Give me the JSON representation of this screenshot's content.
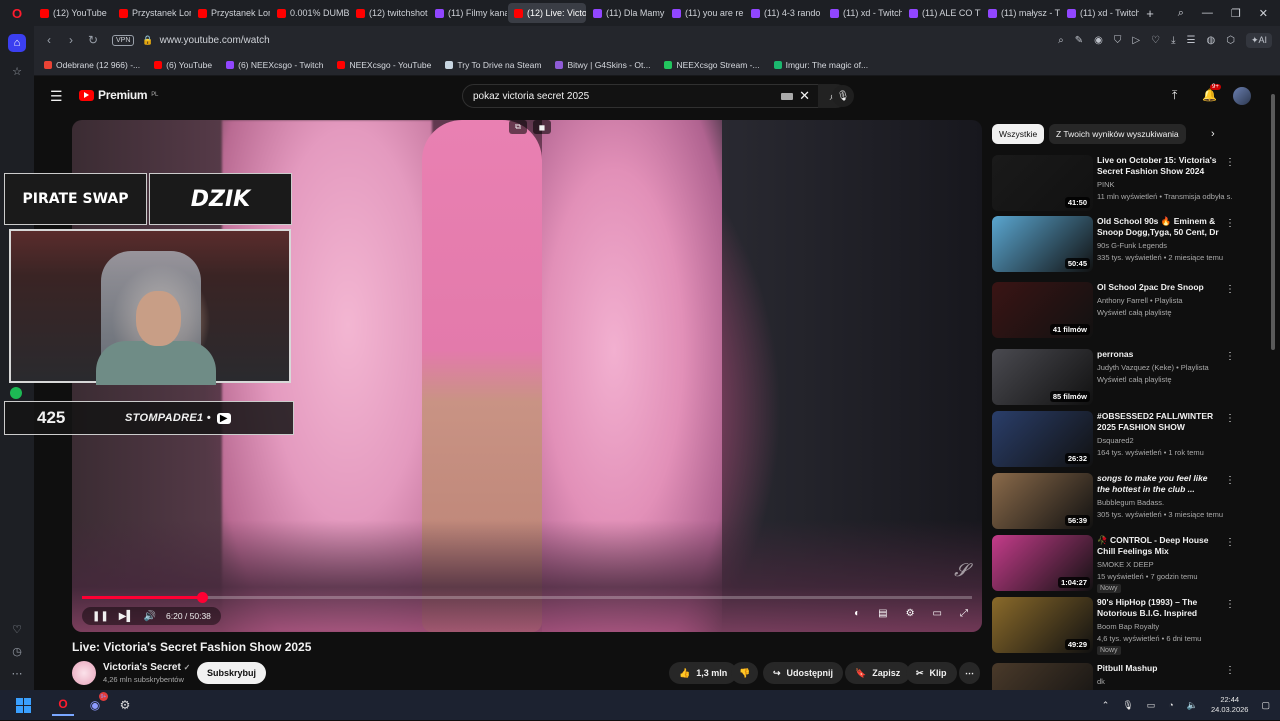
{
  "browser": {
    "tabs": [
      {
        "label": "(12) YouTube",
        "kind": "yt",
        "active": false
      },
      {
        "label": "Przystanek Lom",
        "kind": "yt",
        "active": false
      },
      {
        "label": "Przystanek Lom",
        "kind": "yt",
        "active": false
      },
      {
        "label": "0.001% DUMB",
        "kind": "yt",
        "active": false
      },
      {
        "label": "(12) twitchshot",
        "kind": "yt",
        "active": false
      },
      {
        "label": "(11) Filmy kana",
        "kind": "tw",
        "active": false
      },
      {
        "label": "(12) Live: Victoria's Se",
        "kind": "yt",
        "active": true
      },
      {
        "label": "(11) Dla Mamy",
        "kind": "tw",
        "active": false
      },
      {
        "label": "(11) you are re",
        "kind": "tw",
        "active": false
      },
      {
        "label": "(11) 4-3 rando",
        "kind": "tw",
        "active": false
      },
      {
        "label": "(11) xd - Twitch",
        "kind": "tw",
        "active": false
      },
      {
        "label": "(11) ALE CO TY",
        "kind": "tw",
        "active": false
      },
      {
        "label": "(11) małysz - T",
        "kind": "tw",
        "active": false
      },
      {
        "label": "(11) xd - Twitch",
        "kind": "tw",
        "active": false
      }
    ],
    "new_tab": "+",
    "vpn_label": "VPN",
    "url": "www.youtube.com/watch",
    "ai_label": "AI",
    "bookmarks": [
      {
        "label": "Odebrane (12 966) -...",
        "color": "#ea4335"
      },
      {
        "label": "(6) YouTube",
        "color": "#ff0000"
      },
      {
        "label": "(6) NEEXcsgo - Twitch",
        "color": "#9146ff"
      },
      {
        "label": "NEEXcsgo - YouTube",
        "color": "#ff0000"
      },
      {
        "label": "Try To Drive na Steam",
        "color": "#c7d5e0"
      },
      {
        "label": "Bitwy | G4Skins - Ot...",
        "color": "#8e5bd6"
      },
      {
        "label": "NEEXcsgo Stream -...",
        "color": "#22c55e"
      },
      {
        "label": "Imgur: The magic of...",
        "color": "#1bb76e"
      }
    ]
  },
  "youtube": {
    "logo_text": "Premium",
    "logo_region": "PL",
    "search_value": "pokaz victoria secret 2025",
    "notifications": "9+",
    "video": {
      "title": "Live: Victoria's Secret Fashion Show 2025",
      "time": "6:20 / 50:38",
      "progress": 0.135
    },
    "stream_overlay": {
      "sponsor_a": "PIRATE SWAP",
      "sponsor_b": "DZIK",
      "counter": "425",
      "handle": "STOMPADRE1 •"
    },
    "channel": {
      "name": "Victoria's Secret",
      "verified": "✓",
      "subscribers": "4,26 mln subskrybentów",
      "subscribe_label": "Subskrybuj"
    },
    "actions": {
      "likes": "1,3 mln",
      "share": "Udostępnij",
      "save": "Zapisz",
      "clip": "Klip",
      "more": "⋯"
    },
    "chips": [
      "Wszystkie",
      "Z Twoich wyników wyszukiwania"
    ],
    "recommendations": [
      {
        "title": "Live on October 15: Victoria's Secret Fashion Show 2024",
        "channel": "PINK",
        "meta": "11 mln wyświetleń • Transmisja odbyła s...",
        "badge": "41:50",
        "italic": false,
        "new": "",
        "thumb": "#1a1a1a"
      },
      {
        "title": "Old School 90s 🔥 Eminem & Snoop Dogg,Tyga, 50 Cent, Dr ...",
        "channel": "90s G-Funk Legends",
        "meta": "335 tys. wyświetleń • 2 miesiące temu",
        "badge": "50:45",
        "italic": false,
        "new": "",
        "thumb": "#5aa6d0"
      },
      {
        "title": "Ol School 2pac Dre Snoop",
        "channel": "Anthony Farrell • Playlista",
        "meta": "Wyświetl całą playlistę",
        "badge": "41 filmów",
        "italic": false,
        "new": "",
        "thumb": "#3a1414"
      },
      {
        "title": "perronas",
        "channel": "Judyth Vazquez (Keke) • Playlista",
        "meta": "Wyświetl całą playlistę",
        "badge": "85 filmów",
        "italic": false,
        "new": "",
        "thumb": "#4a4a50"
      },
      {
        "title": "#OBSESSED2 FALL/WINTER 2025 FASHION SHOW",
        "channel": "Dsquared2",
        "meta": "164 tys. wyświetleń • 1 rok temu",
        "badge": "26:32",
        "italic": false,
        "new": "",
        "thumb": "#2a3e6a"
      },
      {
        "title": "songs to make you feel like the hottest in the club ...",
        "channel": "Bubblegum Badass.",
        "meta": "305 tys. wyświetleń • 3 miesiące temu",
        "badge": "56:39",
        "italic": true,
        "new": "",
        "thumb": "#8a6a4a"
      },
      {
        "title": "🥀 CONTROL - Deep House Chill Feelings Mix",
        "channel": "SMOKE X DEEP",
        "meta": "15 wyświetleń • 7 godzin temu",
        "badge": "1:04:27",
        "italic": false,
        "new": "Nowy",
        "thumb": "#c43c8a"
      },
      {
        "title": "90's HipHop (1993) – The Notorious B.I.G. Inspired Tribu...",
        "channel": "Boom Bap Royalty",
        "meta": "4,6 tys. wyświetleń • 6 dni temu",
        "badge": "49:29",
        "italic": false,
        "new": "Nowy",
        "thumb": "#8a6a2a"
      },
      {
        "title": "Pitbull Mashup",
        "channel": "dk",
        "meta": "",
        "badge": "",
        "italic": false,
        "new": "",
        "thumb": "#4a3a2a"
      }
    ]
  },
  "taskbar": {
    "discord_badge": "9+",
    "time": "22:44",
    "date": "24.03.2026"
  }
}
